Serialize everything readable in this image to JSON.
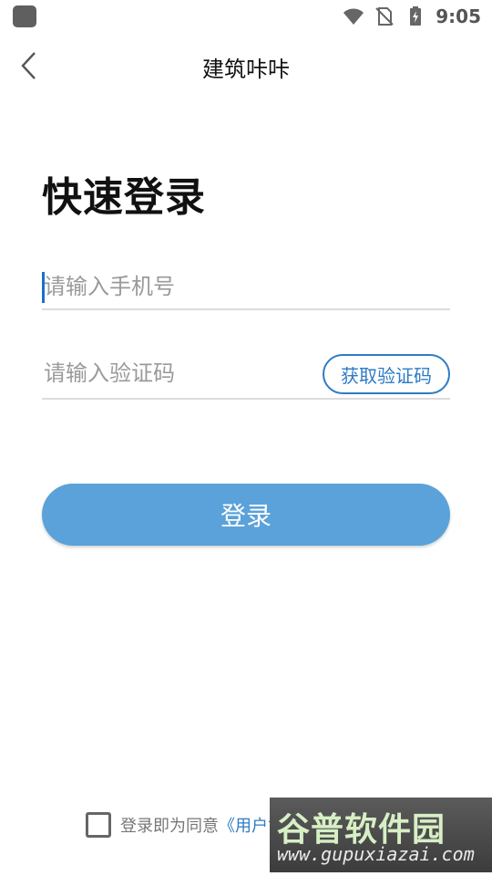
{
  "status_bar": {
    "time": "9:05",
    "icons": [
      "app-icon",
      "wifi-icon",
      "no-sim-icon",
      "battery-charging-icon"
    ]
  },
  "header": {
    "title": "建筑咔咔",
    "back_icon": "chevron-left-icon"
  },
  "main": {
    "page_title": "快速登录",
    "phone": {
      "placeholder": "请输入手机号",
      "value": ""
    },
    "code": {
      "placeholder": "请输入验证码",
      "value": ""
    },
    "get_code_label": "获取验证码",
    "login_label": "登录"
  },
  "footer": {
    "agree_text": "登录即为同意",
    "agree_link": "《用户协"
  },
  "watermark": {
    "top": "谷普软件园",
    "bottom": "www.gupuxiazai.com"
  },
  "colors": {
    "accent": "#2e7bc4",
    "login_button": "#5aa2d9",
    "divider": "#dcdcdc",
    "placeholder": "#9a9a9a"
  }
}
